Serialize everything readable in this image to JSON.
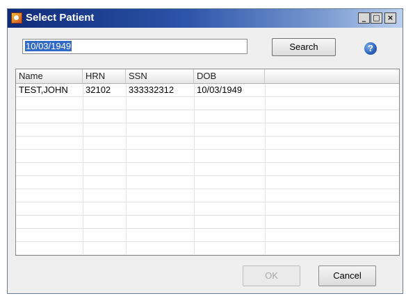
{
  "window": {
    "title": "Select Patient",
    "minimize_glyph": "_",
    "maximize_glyph": "□",
    "close_glyph": "×"
  },
  "search": {
    "value": "10/03/1949",
    "button_label": "Search",
    "help_glyph": "?"
  },
  "table": {
    "columns": [
      "Name",
      "HRN",
      "SSN",
      "DOB",
      ""
    ],
    "rows": [
      [
        "TEST,JOHN",
        "32102",
        "333332312",
        "10/03/1949",
        ""
      ]
    ]
  },
  "footer": {
    "ok_label": "OK",
    "cancel_label": "Cancel"
  },
  "colors": {
    "titlebar_start": "#0f2b78",
    "titlebar_end": "#bcd0ee",
    "selection": "#3169c6"
  },
  "icons": {
    "app": "patient-app-icon",
    "help": "help-icon"
  }
}
